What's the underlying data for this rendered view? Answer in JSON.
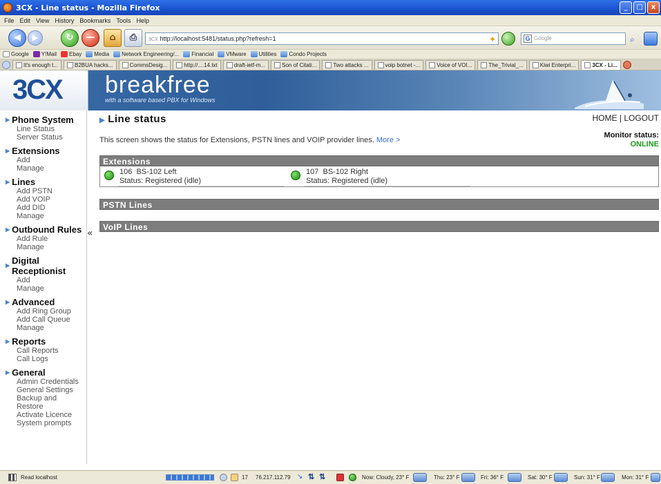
{
  "window": {
    "title": "3CX - Line status - Mozilla Firefox",
    "controls": [
      "_",
      "□",
      "x"
    ]
  },
  "menubar": [
    "File",
    "Edit",
    "View",
    "History",
    "Bookmarks",
    "Tools",
    "Help"
  ],
  "navbar": {
    "url_proto": "3CX",
    "url": "http://localhost:5481/status.php?refresh=1",
    "search_placeholder": "Google",
    "search_engine_glyph": "G"
  },
  "bookmarks": [
    {
      "label": "Google",
      "icon": "google-icon"
    },
    {
      "label": "Y!Mail",
      "icon": "yahoo-icon"
    },
    {
      "label": "Ebay",
      "icon": "ebay-icon"
    },
    {
      "label": "Media",
      "icon": "folder-icon"
    },
    {
      "label": "Network Engineering/...",
      "icon": "folder-icon"
    },
    {
      "label": "Financial",
      "icon": "folder-icon"
    },
    {
      "label": "VMware",
      "icon": "folder-icon"
    },
    {
      "label": "Utilities",
      "icon": "folder-icon"
    },
    {
      "label": "Condo Projects",
      "icon": "folder-icon"
    }
  ],
  "tabs": [
    {
      "label": "It's enough t...",
      "active": false
    },
    {
      "label": "B2BUA hacks...",
      "active": false
    },
    {
      "label": "CommsDesig...",
      "active": false
    },
    {
      "label": "http://....14.txt",
      "active": false
    },
    {
      "label": "draft-ietf-m...",
      "active": false
    },
    {
      "label": "Son of Citati...",
      "active": false
    },
    {
      "label": "Two attacks ...",
      "active": false
    },
    {
      "label": "voip botnet -...",
      "active": false
    },
    {
      "label": "Voice of VOI...",
      "active": false
    },
    {
      "label": "The_Trivial_...",
      "active": false
    },
    {
      "label": "Kiwi Enterpri...",
      "active": false
    },
    {
      "label": "3CX - Li...",
      "active": true
    }
  ],
  "banner": {
    "logo": "3CX",
    "title": "breakfree",
    "subtitle": "with a software based PBX for Windows"
  },
  "leftnav": [
    {
      "heading": "Phone System",
      "items": [
        "Line Status",
        "Server Status"
      ]
    },
    {
      "heading": "Extensions",
      "items": [
        "Add",
        "Manage"
      ]
    },
    {
      "heading": "Lines",
      "items": [
        "Add PSTN",
        "Add VOIP",
        "Add DID",
        "Manage"
      ]
    },
    {
      "heading": "Outbound Rules",
      "items": [
        "Add Rule",
        "Manage"
      ]
    },
    {
      "heading": "Digital Receptionist",
      "items": [
        "Add",
        "Manage"
      ]
    },
    {
      "heading": "Advanced",
      "items": [
        "Add Ring Group",
        "Add Call Queue",
        "Manage"
      ]
    },
    {
      "heading": "Reports",
      "items": [
        "Call Reports",
        "Call Logs"
      ]
    },
    {
      "heading": "General",
      "items": [
        "Admin Credentials",
        "General Settings",
        "Backup and Restore",
        "Activate Licence",
        "System prompts"
      ]
    }
  ],
  "collapse_glyph": "«",
  "main": {
    "title": "Line status",
    "home": "HOME",
    "separator": "|",
    "logout": "LOGOUT",
    "monitor_label": "Monitor status:",
    "monitor_value": "ONLINE",
    "intro": "This screen shows the status for Extensions, PSTN lines and VOIP provider lines.",
    "more_link": "More >",
    "sections": {
      "extensions": "Extensions",
      "pstn": "PSTN Lines",
      "voip": "VoIP Lines"
    },
    "extensions": [
      {
        "number": "106",
        "name": "BS-102 Left",
        "status": "Status: Registered (idle)"
      },
      {
        "number": "107",
        "name": "BS-102 Right",
        "status": "Status: Registered (idle)"
      }
    ]
  },
  "statusbar": {
    "text": "Read localhost",
    "count": "17",
    "ip": "76.217.112.79",
    "weather_now": "Now: Cloudy, 23° F",
    "forecast": [
      "Thu: 23° F",
      "Fri: 36° F",
      "Sat: 30° F",
      "Sun: 31° F",
      "Mon: 31° F"
    ]
  },
  "colors": {
    "accent": "#4a86d4",
    "online": "#1a9a1a",
    "panel_header": "#7d7d7d"
  }
}
